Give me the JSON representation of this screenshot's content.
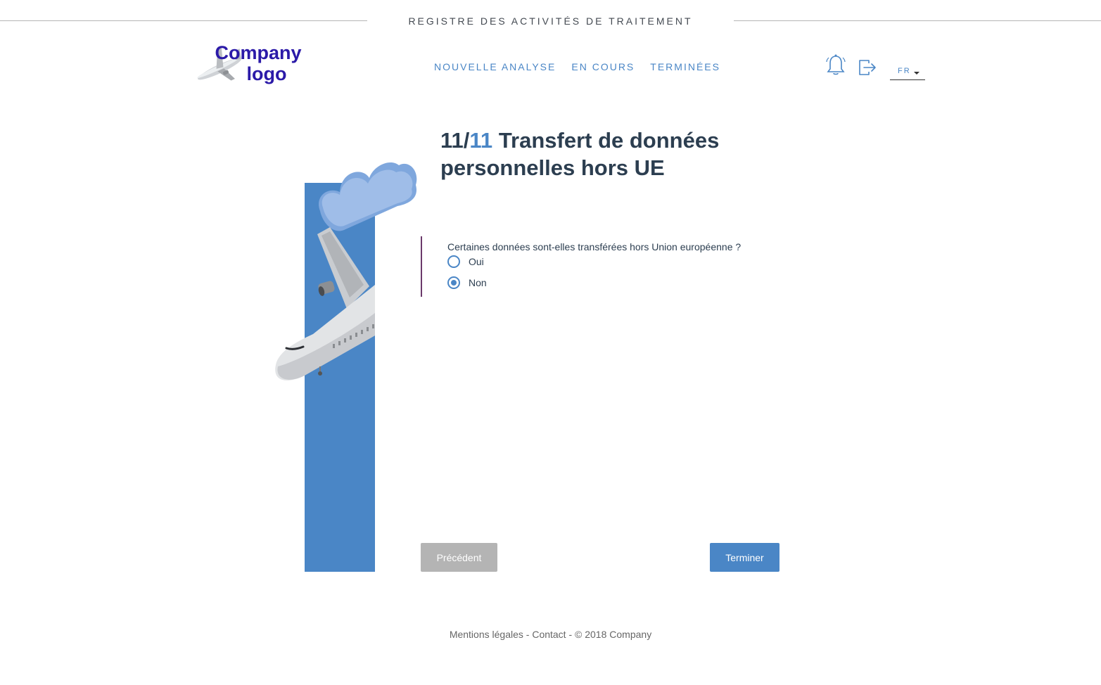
{
  "header": {
    "app_title": "REGISTRE DES ACTIVITÉS DE TRAITEMENT",
    "logo": {
      "line1": "Company",
      "line2": "logo"
    },
    "nav": [
      {
        "label": "NOUVELLE ANALYSE"
      },
      {
        "label": "EN COURS"
      },
      {
        "label": "TERMINÉES"
      }
    ],
    "icons": {
      "notifications": "bell-icon",
      "logout": "logout-icon"
    },
    "language": "FR"
  },
  "step": {
    "current": "11",
    "separator": "/",
    "total": "11",
    "title": "Transfert de données personnelles hors UE"
  },
  "question": {
    "text": "Certaines données sont-elles transférées hors Union européenne ?",
    "options": [
      {
        "label": "Oui",
        "selected": false
      },
      {
        "label": "Non",
        "selected": true
      }
    ]
  },
  "buttons": {
    "previous": "Précédent",
    "finish": "Terminer"
  },
  "footer": {
    "legal": "Mentions légales",
    "sep1": " - ",
    "contact": "Contact",
    "sep2": " - ",
    "copyright": "© 2018 Company"
  },
  "colors": {
    "accent": "#4a86c6",
    "logo_text": "#2b1aa8",
    "heading": "#2c3e50",
    "question_border": "#6b3a6b",
    "previous_button": "#b4b4b4"
  }
}
